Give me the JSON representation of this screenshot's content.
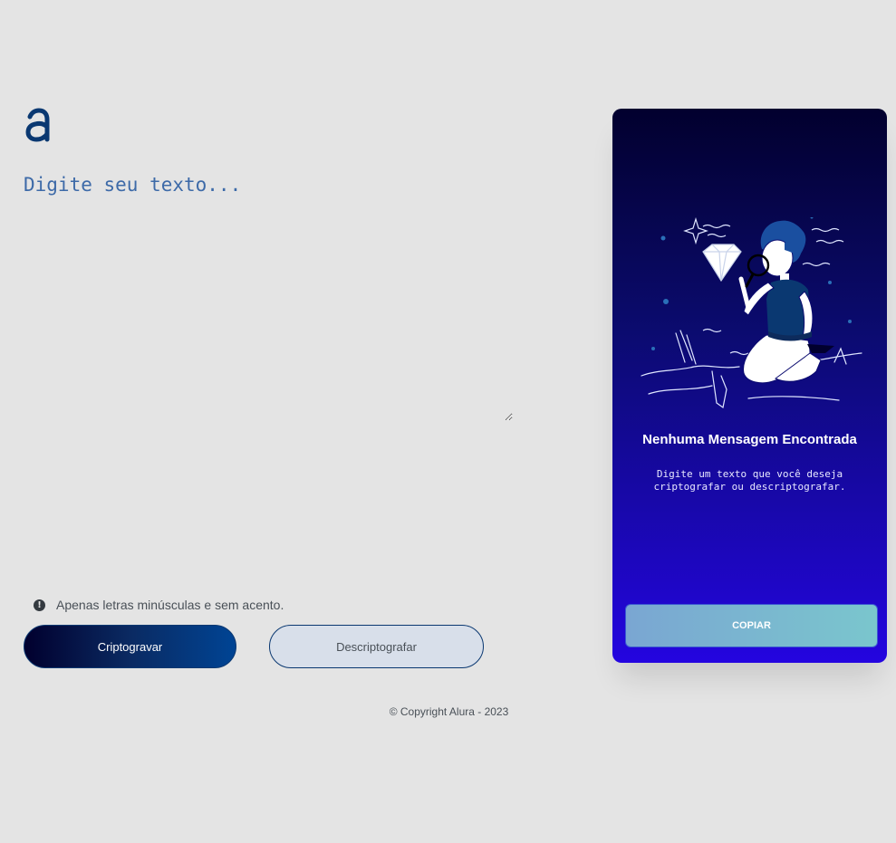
{
  "brand": {
    "logo_letter": "a",
    "logo_icon": "alura-logo-icon",
    "color": "#0a3871"
  },
  "input": {
    "placeholder": "Digite seu texto...",
    "value": ""
  },
  "hint": {
    "icon": "exclamation-circle-icon",
    "text": "Apenas letras minúsculas e sem acento."
  },
  "actions": {
    "encrypt_label": "Criptogravar",
    "decrypt_label": "Descriptografar"
  },
  "output": {
    "illustration": "person-with-magnifying-glass-and-diamond-illustration",
    "title": "Nenhuma Mensagem Encontrada",
    "description": "Digite um texto que você deseja criptografar ou descriptografar.",
    "copy_label": "COPIAR"
  },
  "footer": {
    "copyright": "© Copyright Alura - 2023"
  },
  "colors": {
    "background": "#e4e4e4",
    "accent": "#0a3871",
    "card_top": "#02002e",
    "card_bottom": "#2405e0"
  }
}
